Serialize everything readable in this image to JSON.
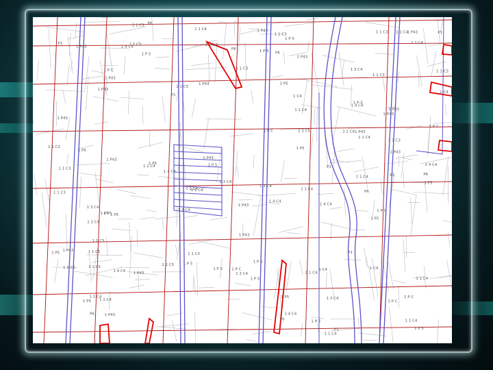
{
  "map": {
    "colors": {
      "parcel_line": "#b9b9c3",
      "road_line": "#5a52c8",
      "highlight_red": "#e00000",
      "grid_red": "#b01010",
      "label_text": "#555555",
      "background": "#ffffff"
    },
    "parcel_labels": [
      "1 1 C4",
      "1 3 C4",
      "1 4 C4",
      "1 1 C3",
      "1 C4",
      "1 P43",
      "1 1 C4",
      "1 P5",
      "1 P 5",
      "1 1 C5",
      "1 P C",
      "P1",
      "P6",
      "1 1 C4",
      "1 P43",
      "1 P5",
      "1 1 C3",
      "1 P 5",
      "1 P43",
      "1 1 C4",
      "1 4 C4",
      "1 P5",
      "1 P43",
      "1 1 C5",
      "1 P C",
      "1 3 C4",
      "1 P 5",
      "1 1 C4",
      "P1",
      "P6",
      "1 P43",
      "1 1 C3"
    ]
  }
}
